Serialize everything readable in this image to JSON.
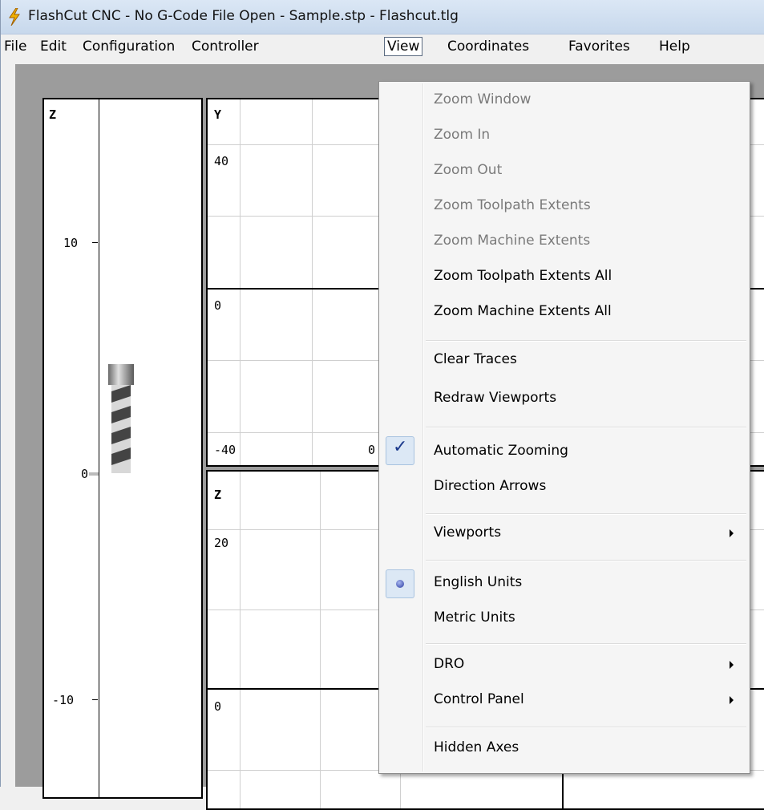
{
  "titlebar": {
    "title": "FlashCut CNC - No G-Code File Open - Sample.stp - Flashcut.tlg",
    "icon": "lightning-bolt-icon"
  },
  "menubar": {
    "items": [
      "File",
      "Edit",
      "Configuration",
      "Controller",
      "View",
      "Coordinates",
      "Favorites",
      "Help"
    ],
    "open_item": "View"
  },
  "viewports": {
    "z_gauge": {
      "axis_label": "Z",
      "ticks": [
        "10",
        "0",
        "-10"
      ]
    },
    "xy": {
      "axis_label": "Y",
      "y_labels": [
        "40",
        "0",
        "-40"
      ],
      "x_labels": [
        "0"
      ]
    },
    "xz": {
      "axis_label": "Z",
      "y_labels": [
        "20",
        "0"
      ]
    }
  },
  "view_menu": {
    "items": [
      {
        "label": "Zoom Window",
        "enabled": false
      },
      {
        "label": "Zoom In",
        "enabled": false
      },
      {
        "label": "Zoom Out",
        "enabled": false
      },
      {
        "label": "Zoom Toolpath Extents",
        "enabled": false
      },
      {
        "label": "Zoom Machine Extents",
        "enabled": false
      },
      {
        "label": "Zoom Toolpath Extents All",
        "enabled": true
      },
      {
        "label": "Zoom Machine Extents All",
        "enabled": true
      },
      {
        "label": "Clear Traces",
        "enabled": true
      },
      {
        "label": "Redraw Viewports",
        "enabled": true
      },
      {
        "label": "Automatic Zooming",
        "enabled": true,
        "checked": true
      },
      {
        "label": "Direction Arrows",
        "enabled": true
      },
      {
        "label": "Viewports",
        "enabled": true,
        "submenu": true
      },
      {
        "label": "English Units",
        "enabled": true,
        "radio_selected": true
      },
      {
        "label": "Metric Units",
        "enabled": true
      },
      {
        "label": "DRO",
        "enabled": true,
        "submenu": true
      },
      {
        "label": "Control Panel",
        "enabled": true,
        "submenu": true
      },
      {
        "label": "Hidden Axes",
        "enabled": true
      }
    ]
  },
  "colors": {
    "disabled_text": "#7a7a7a",
    "check_highlight": "#dce8f5",
    "titlebar": "#c7d8ec"
  }
}
